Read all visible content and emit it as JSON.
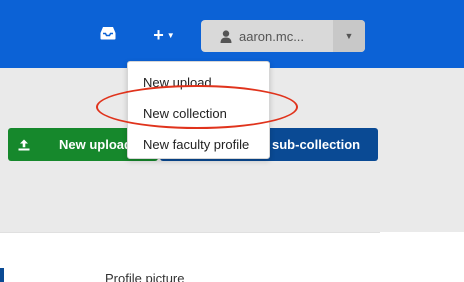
{
  "colors": {
    "topbar": "#0c62d6",
    "graybar": "#eaeaea",
    "upload_button": "#16882c",
    "collection_button": "#0a4a94",
    "highlight_ring": "#e0331c"
  },
  "header": {
    "inbox_icon": "inbox-icon",
    "add_icon": "plus-icon",
    "user": {
      "name": "aaron.mc...",
      "icon": "person-icon"
    }
  },
  "add_menu": {
    "items": [
      {
        "label": "New upload"
      },
      {
        "label": "New collection"
      },
      {
        "label": "New faculty profile"
      }
    ]
  },
  "actions": {
    "new_upload": "New upload",
    "sub_collection": "sub-collection"
  },
  "content": {
    "profile_label": "Profile picture"
  }
}
